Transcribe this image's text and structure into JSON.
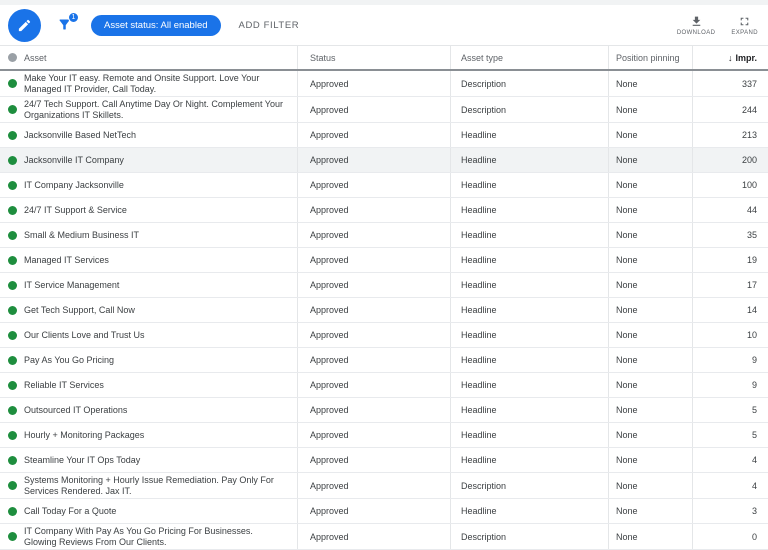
{
  "toolbar": {
    "filter_badge": "1",
    "chip_label": "Asset status: All enabled",
    "add_filter_label": "ADD FILTER",
    "download_label": "DOWNLOAD",
    "expand_label": "EXPAND"
  },
  "colors": {
    "accent_blue": "#1a73e8",
    "approved_green": "#1e8e3e",
    "row_highlight": "#f1f3f4",
    "header_text": "#5f6368"
  },
  "icons": {
    "edit": "pencil-icon",
    "filter": "funnel-icon",
    "download": "download-icon",
    "expand": "fullscreen-icon",
    "sort": "arrow-down"
  },
  "table": {
    "columns": [
      "Asset",
      "Status",
      "Asset type",
      "Position pinning",
      "Impr."
    ],
    "sort": {
      "column": "Impr.",
      "direction": "desc",
      "arrow": "↓"
    },
    "rows": [
      {
        "asset": "Make Your IT easy. Remote and Onsite Support. Love Your Managed IT Provider, Call Today.",
        "status": "Approved",
        "type": "Description",
        "pinning": "None",
        "impr": "337",
        "highlighted": false
      },
      {
        "asset": "24/7 Tech Support. Call Anytime Day Or Night. Complement Your Organizations IT Skillets.",
        "status": "Approved",
        "type": "Description",
        "pinning": "None",
        "impr": "244",
        "highlighted": false
      },
      {
        "asset": "Jacksonville Based NetTech",
        "status": "Approved",
        "type": "Headline",
        "pinning": "None",
        "impr": "213",
        "highlighted": false
      },
      {
        "asset": "Jacksonville IT Company",
        "status": "Approved",
        "type": "Headline",
        "pinning": "None",
        "impr": "200",
        "highlighted": true
      },
      {
        "asset": "IT Company Jacksonville",
        "status": "Approved",
        "type": "Headline",
        "pinning": "None",
        "impr": "100",
        "highlighted": false
      },
      {
        "asset": "24/7 IT Support & Service",
        "status": "Approved",
        "type": "Headline",
        "pinning": "None",
        "impr": "44",
        "highlighted": false
      },
      {
        "asset": "Small & Medium Business IT",
        "status": "Approved",
        "type": "Headline",
        "pinning": "None",
        "impr": "35",
        "highlighted": false
      },
      {
        "asset": "Managed IT Services",
        "status": "Approved",
        "type": "Headline",
        "pinning": "None",
        "impr": "19",
        "highlighted": false
      },
      {
        "asset": "IT Service Management",
        "status": "Approved",
        "type": "Headline",
        "pinning": "None",
        "impr": "17",
        "highlighted": false
      },
      {
        "asset": "Get Tech Support, Call Now",
        "status": "Approved",
        "type": "Headline",
        "pinning": "None",
        "impr": "14",
        "highlighted": false
      },
      {
        "asset": "Our Clients Love and Trust Us",
        "status": "Approved",
        "type": "Headline",
        "pinning": "None",
        "impr": "10",
        "highlighted": false
      },
      {
        "asset": "Pay As You Go Pricing",
        "status": "Approved",
        "type": "Headline",
        "pinning": "None",
        "impr": "9",
        "highlighted": false
      },
      {
        "asset": "Reliable IT Services",
        "status": "Approved",
        "type": "Headline",
        "pinning": "None",
        "impr": "9",
        "highlighted": false
      },
      {
        "asset": "Outsourced IT Operations",
        "status": "Approved",
        "type": "Headline",
        "pinning": "None",
        "impr": "5",
        "highlighted": false
      },
      {
        "asset": "Hourly + Monitoring Packages",
        "status": "Approved",
        "type": "Headline",
        "pinning": "None",
        "impr": "5",
        "highlighted": false
      },
      {
        "asset": "Steamline Your IT Ops Today",
        "status": "Approved",
        "type": "Headline",
        "pinning": "None",
        "impr": "4",
        "highlighted": false
      },
      {
        "asset": "Systems Monitoring + Hourly Issue Remediation. Pay Only For Services Rendered. Jax IT.",
        "status": "Approved",
        "type": "Description",
        "pinning": "None",
        "impr": "4",
        "highlighted": false
      },
      {
        "asset": "Call Today For a Quote",
        "status": "Approved",
        "type": "Headline",
        "pinning": "None",
        "impr": "3",
        "highlighted": false
      },
      {
        "asset": "IT Company With Pay As You Go Pricing For Businesses. Glowing Reviews From Our Clients.",
        "status": "Approved",
        "type": "Description",
        "pinning": "None",
        "impr": "0",
        "highlighted": false
      }
    ]
  }
}
